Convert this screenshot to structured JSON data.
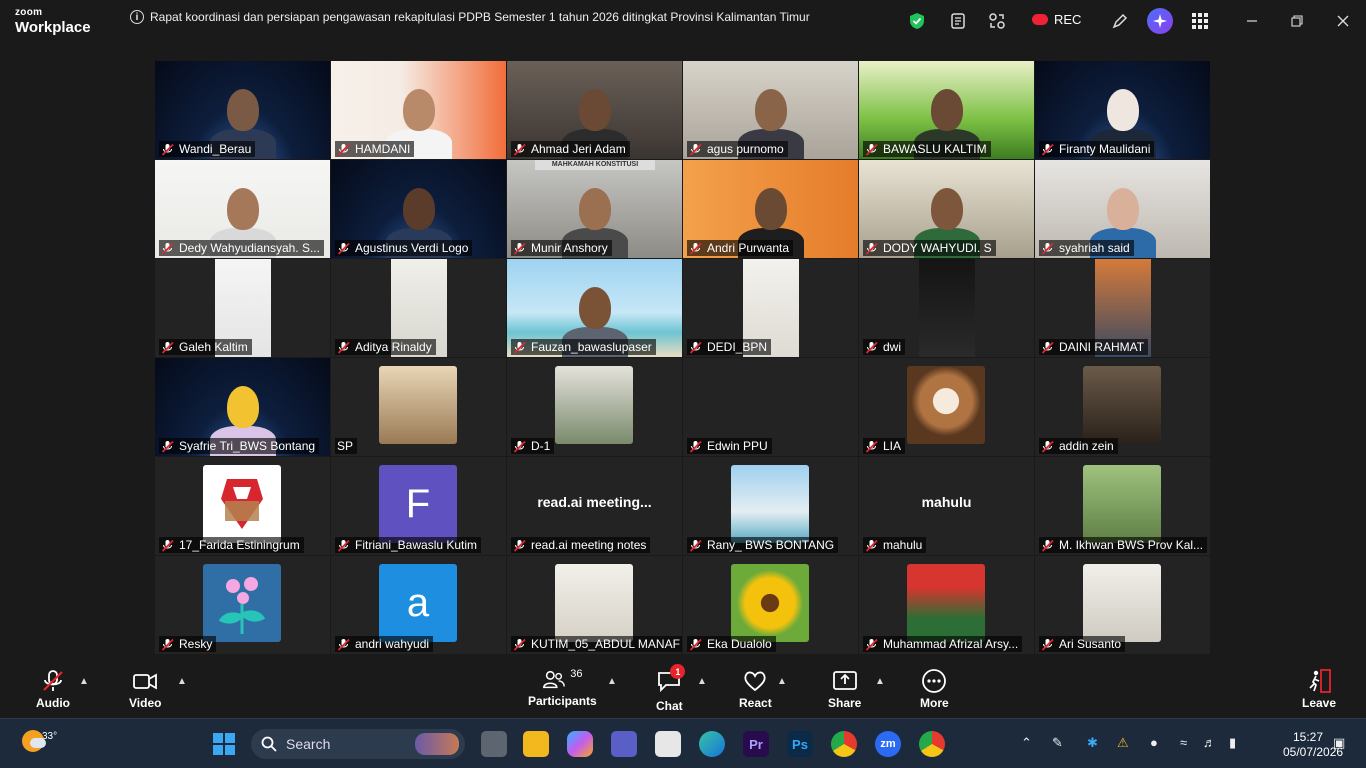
{
  "app": {
    "brand_line1": "zoom",
    "brand_line2": "Workplace"
  },
  "meeting": {
    "title": "Rapat koordinasi dan persiapan pengawasan rekapitulasi PDPB Semester 1 tahun 2026 ditingkat Provinsi Kalimantan Timur",
    "rec_label": "REC"
  },
  "participants": [
    {
      "name": "Wandi_Berau"
    },
    {
      "name": "HAMDANI"
    },
    {
      "name": "Ahmad Jeri Adam"
    },
    {
      "name": "agus purnomo"
    },
    {
      "name": "BAWASLU KALTIM"
    },
    {
      "name": "Firanty Maulidani"
    },
    {
      "name": "Dedy Wahyudiansyah. S..."
    },
    {
      "name": "Agustinus Verdi Logo"
    },
    {
      "name": "Munir Anshory"
    },
    {
      "name": "Andri Purwanta"
    },
    {
      "name": "DODY WAHYUDI. S"
    },
    {
      "name": "syahriah said"
    },
    {
      "name": "Galeh Kaltim"
    },
    {
      "name": "Aditya Rinaldy"
    },
    {
      "name": "Fauzan_bawaslupaser"
    },
    {
      "name": "DEDI_BPN"
    },
    {
      "name": "dwi"
    },
    {
      "name": "DAINI RAHMAT"
    },
    {
      "name": "Syafrie Tri_BWS Bontang"
    },
    {
      "name": "SP"
    },
    {
      "name": "D-1"
    },
    {
      "name": "Edwin PPU"
    },
    {
      "name": "LIA"
    },
    {
      "name": "addin zein"
    },
    {
      "name": "17_Farida Estiningrum"
    },
    {
      "name": "Fitriani_Bawaslu Kutim"
    },
    {
      "name": "read.ai meeting notes",
      "big": "read.ai  meeting..."
    },
    {
      "name": "Rany_ BWS BONTANG"
    },
    {
      "name": "mahulu",
      "big": "mahulu"
    },
    {
      "name": "M. Ikhwan BWS Prov Kal..."
    },
    {
      "name": "Resky"
    },
    {
      "name": "andri wahyudi"
    },
    {
      "name": "KUTIM_05_ABDUL MANAF"
    },
    {
      "name": "Eka Dualolo"
    },
    {
      "name": "Muhammad Afrizal Arsy..."
    },
    {
      "name": "Ari Susanto"
    }
  ],
  "avatar_letters": {
    "fitriani": "F",
    "andri": "a"
  },
  "sign_text": "MAHKAMAH KONSTITUSI",
  "toolbar": {
    "audio": "Audio",
    "video": "Video",
    "participants": "Participants",
    "participants_count": "36",
    "chat": "Chat",
    "chat_badge": "1",
    "react": "React",
    "share": "Share",
    "more": "More",
    "leave": "Leave"
  },
  "taskbar": {
    "temperature": "33°",
    "search_placeholder": "Search",
    "time": "15:27",
    "date": "05/07/2026"
  },
  "colors": {
    "accent_active": "#3ee07e",
    "leave_red": "#e5242b",
    "rec_red": "#e22233"
  }
}
